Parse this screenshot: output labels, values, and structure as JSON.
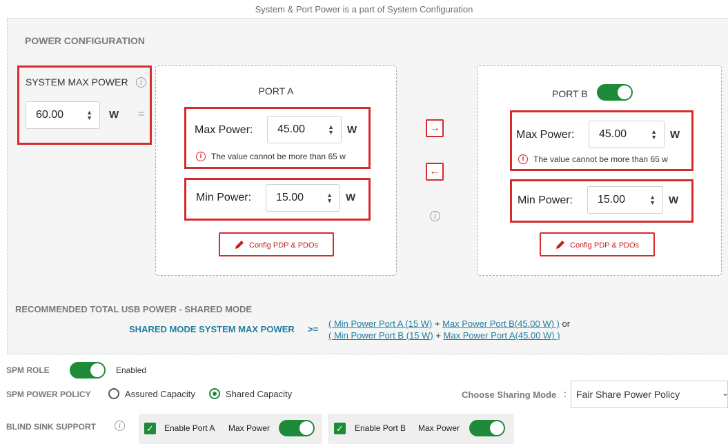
{
  "caption": "System & Port Power is a part of System Configuration",
  "power_config": {
    "title": "POWER CONFIGURATION",
    "system_max_power": {
      "label": "SYSTEM MAX POWER",
      "value": "60.00",
      "unit": "W",
      "equals": "="
    },
    "port_a": {
      "title": "PORT A",
      "max_label": "Max Power:",
      "max_value": "45.00",
      "max_unit": "W",
      "error": "The value cannot be more than 65 w",
      "min_label": "Min Power:",
      "min_value": "15.00",
      "min_unit": "W",
      "config_button": "Config PDP & PDOs"
    },
    "port_b": {
      "title": "PORT B",
      "max_label": "Max Power:",
      "max_value": "45.00",
      "max_unit": "W",
      "error": "The value cannot be more than 65 w",
      "min_label": "Min Power:",
      "min_value": "15.00",
      "min_unit": "W",
      "config_button": "Config PDP & PDOs"
    },
    "arrows": {
      "right": "→",
      "left": "←"
    }
  },
  "recommended": {
    "title": "RECOMMENDED TOTAL USB POWER - SHARED MODE",
    "label": "SHARED MODE SYSTEM MAX POWER",
    "operator": ">=",
    "line1_a": "( Min Power Port A (15 W)",
    "line1_plus": " + ",
    "line1_b": "Max Power Port B(45.00 W) )",
    "line1_or": " or",
    "line2_a": "( Min Power Port B (15 W)",
    "line2_plus": " + ",
    "line2_b": "Max Power Port A(45.00 W) )"
  },
  "spm_role": {
    "label": "SPM ROLE",
    "state": "Enabled"
  },
  "spm_policy": {
    "label": "SPM POWER POLICY",
    "option1": "Assured Capacity",
    "option2": "Shared Capacity",
    "selected": "Shared Capacity",
    "sharing_label": "Choose Sharing Mode",
    "sharing_colon": ":",
    "sharing_value": "Fair Share Power Policy"
  },
  "blind_sink": {
    "label": "BLIND SINK SUPPORT",
    "port_a_label": "Enable Port A",
    "port_a_toggle_label": "Max Power",
    "port_b_label": "Enable Port B",
    "port_b_toggle_label": "Max Power"
  },
  "icons": {
    "info": "i",
    "error": "i",
    "check": "✓",
    "pencil": "pencil-icon",
    "chevron": "chevron-down-icon"
  },
  "colors": {
    "accent_red": "#d62b2b",
    "toggle_green": "#1e8a3a",
    "link_teal": "#1f7ea1"
  }
}
